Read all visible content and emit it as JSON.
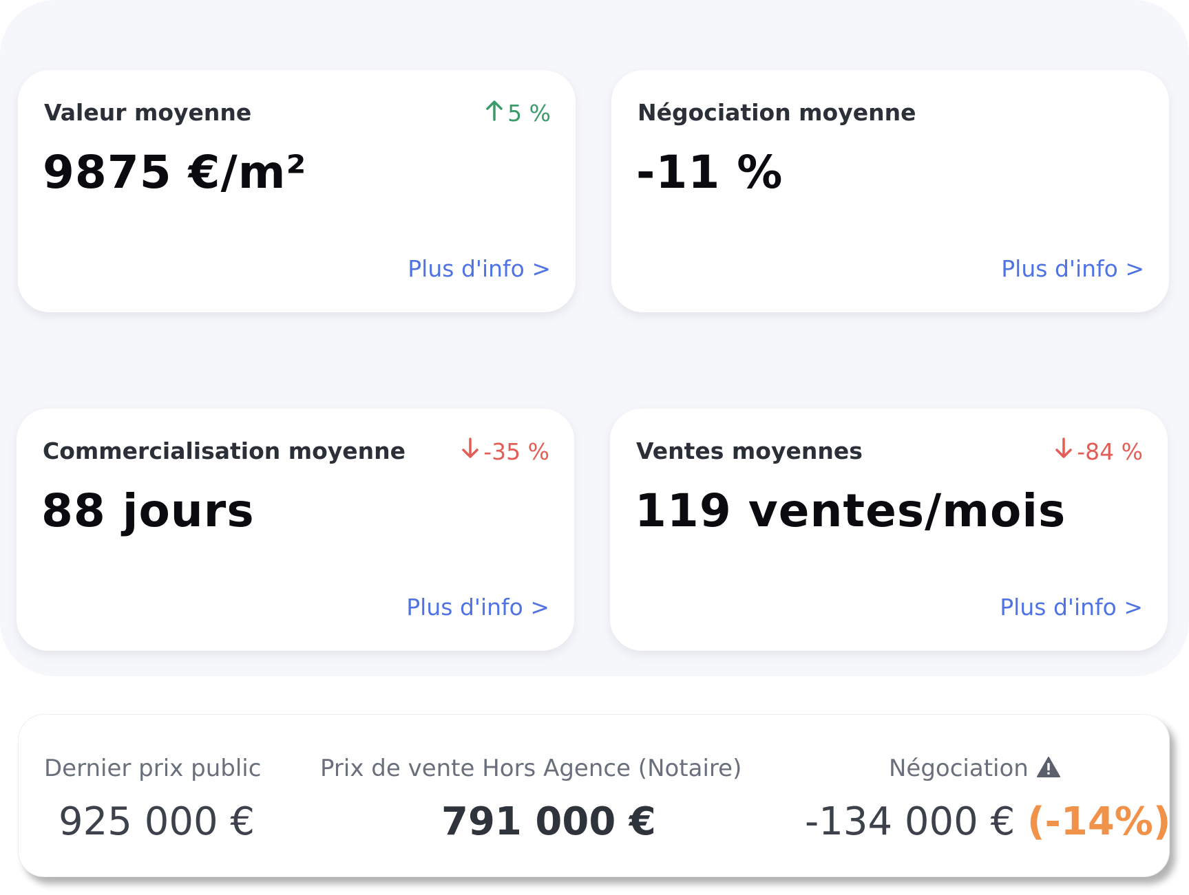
{
  "cards": [
    {
      "title": "Valeur moyenne",
      "value": "9875 €/m²",
      "trend": {
        "direction": "up",
        "text": "5 %",
        "icon": "arrow-up-icon",
        "color": "#3a9a6a"
      },
      "link": "Plus d'info >"
    },
    {
      "title": "Négociation moyenne",
      "value": "-11 %",
      "trend": null,
      "link": "Plus d'info >"
    },
    {
      "title": "Commercialisation moyenne",
      "value": "88 jours",
      "trend": {
        "direction": "down",
        "text": "-35 %",
        "icon": "arrow-down-icon",
        "color": "#e35d55"
      },
      "link": "Plus d'info >"
    },
    {
      "title": "Ventes moyennes",
      "value": "119 ventes/mois",
      "trend": {
        "direction": "down",
        "text": "-84 %",
        "icon": "arrow-down-icon",
        "color": "#e35d55"
      },
      "link": "Plus d'info >"
    }
  ],
  "price_summary": {
    "public_price": {
      "label": "Dernier prix public",
      "value": "925 000 €"
    },
    "sale_price": {
      "label": "Prix de vente Hors Agence (Notaire)",
      "value": "791 000 €"
    },
    "negotiation": {
      "label": "Négociation",
      "icon": "warning-icon",
      "value": "-134 000 €",
      "percent": "(-14%)",
      "percent_color": "#f0924a"
    }
  },
  "colors": {
    "link": "#4f73e3",
    "panel_background": "#f6f7fb"
  }
}
